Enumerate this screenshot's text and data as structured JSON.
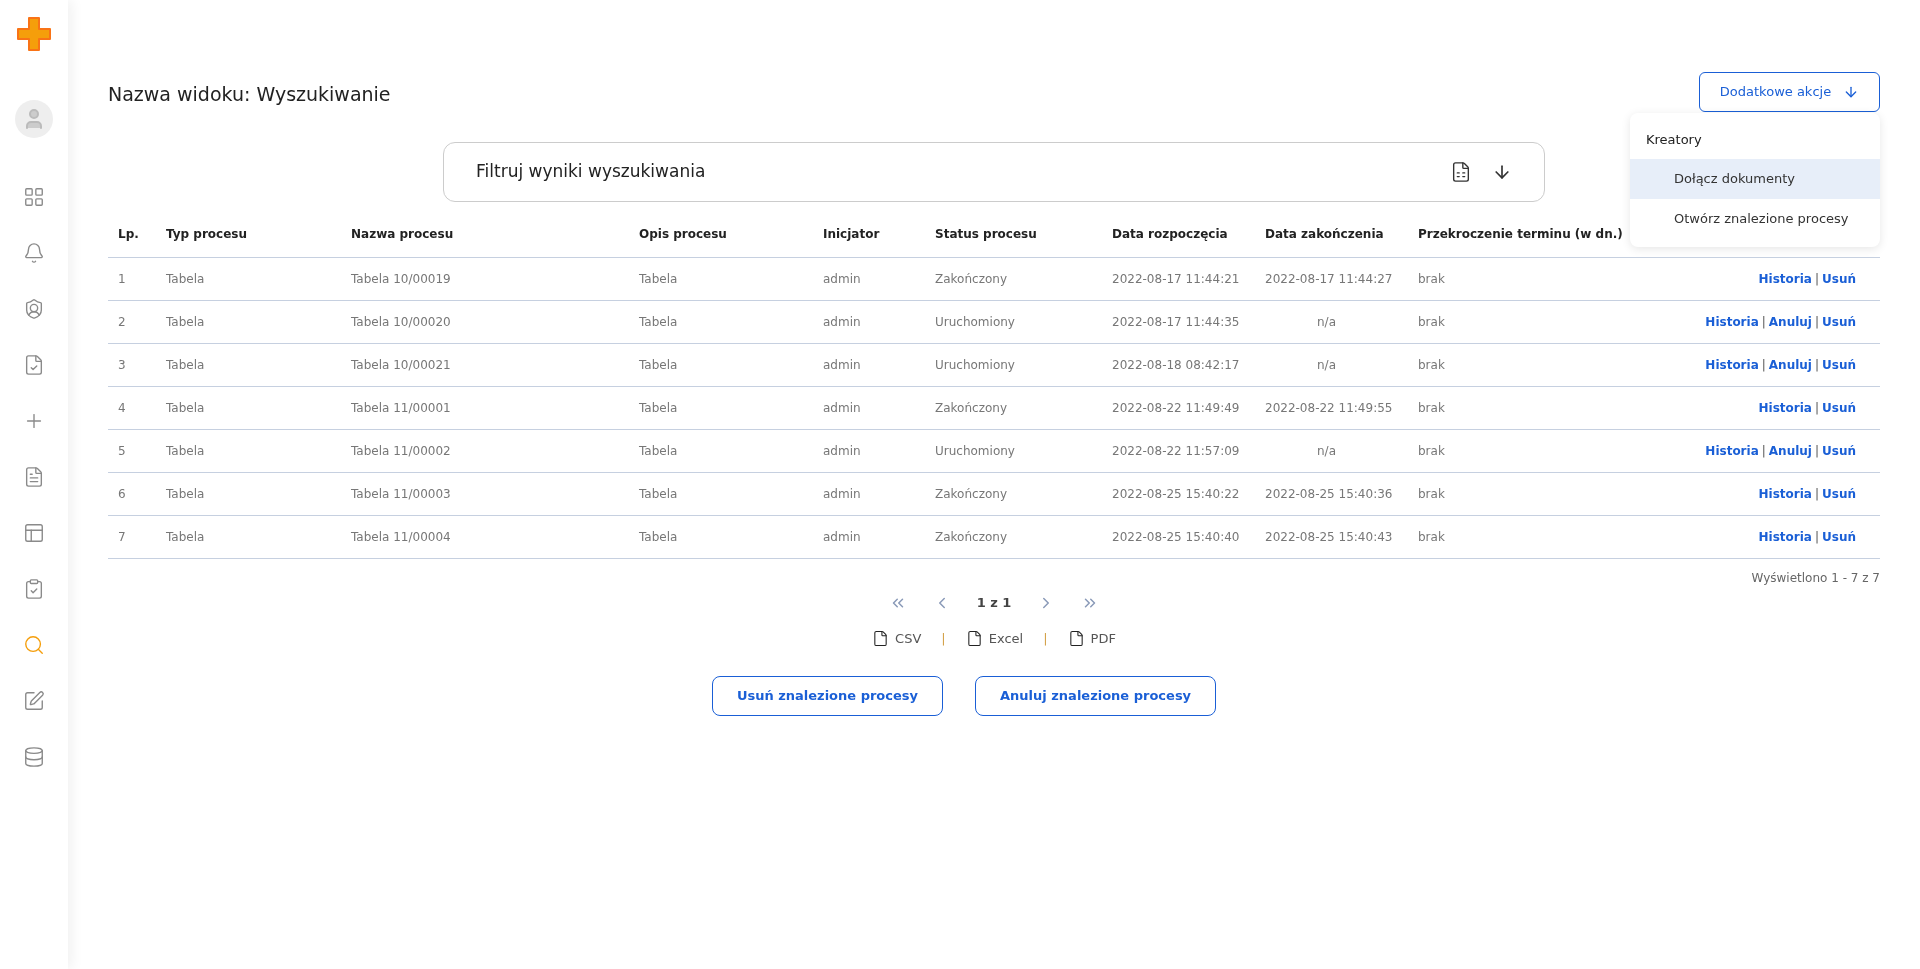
{
  "sidebar": {
    "items": [
      {
        "selected": false
      },
      {
        "selected": false
      },
      {
        "selected": false
      },
      {
        "selected": false
      },
      {
        "selected": false
      },
      {
        "selected": false
      },
      {
        "selected": false
      },
      {
        "selected": false
      },
      {
        "selected": true
      },
      {
        "selected": false
      },
      {
        "selected": false
      }
    ]
  },
  "title": "Nazwa widoku: Wyszukiwanie",
  "actions_menu": {
    "label": "Dodatkowe akcje",
    "expanded": true,
    "heading": "Kreatory",
    "items": [
      {
        "label": "Dołącz dokumenty",
        "selected": true
      },
      {
        "label": "Otwórz znalezione procesy",
        "selected": false
      }
    ]
  },
  "filter": {
    "label": "Filtruj wyniki wyszukiwania"
  },
  "table": {
    "columns": [
      "Lp.",
      "Typ procesu",
      "Nazwa procesu",
      "Opis procesu",
      "Inicjator",
      "Status procesu",
      "Data rozpoczęcia",
      "Data zakończenia",
      "Przekroczenie terminu (w dn.)"
    ],
    "rows": [
      {
        "cells": [
          "1",
          "Tabela",
          "Tabela 10/00019",
          "Tabela",
          "admin",
          "Zakończony",
          "2022-08-17 11:44:21",
          "2022-08-17 11:44:27",
          "brak"
        ],
        "links": [
          "Historia",
          "Usuń"
        ]
      },
      {
        "cells": [
          "2",
          "Tabela",
          "Tabela 10/00020",
          "Tabela",
          "admin",
          "Uruchomiony",
          "2022-08-17 11:44:35",
          "n/a",
          "brak"
        ],
        "links": [
          "Historia",
          "Anuluj",
          "Usuń"
        ]
      },
      {
        "cells": [
          "3",
          "Tabela",
          "Tabela 10/00021",
          "Tabela",
          "admin",
          "Uruchomiony",
          "2022-08-18 08:42:17",
          "n/a",
          "brak"
        ],
        "links": [
          "Historia",
          "Anuluj",
          "Usuń"
        ]
      },
      {
        "cells": [
          "4",
          "Tabela",
          "Tabela 11/00001",
          "Tabela",
          "admin",
          "Zakończony",
          "2022-08-22 11:49:49",
          "2022-08-22 11:49:55",
          "brak"
        ],
        "links": [
          "Historia",
          "Usuń"
        ]
      },
      {
        "cells": [
          "5",
          "Tabela",
          "Tabela 11/00002",
          "Tabela",
          "admin",
          "Uruchomiony",
          "2022-08-22 11:57:09",
          "n/a",
          "brak"
        ],
        "links": [
          "Historia",
          "Anuluj",
          "Usuń"
        ]
      },
      {
        "cells": [
          "6",
          "Tabela",
          "Tabela 11/00003",
          "Tabela",
          "admin",
          "Zakończony",
          "2022-08-25 15:40:22",
          "2022-08-25 15:40:36",
          "brak"
        ],
        "links": [
          "Historia",
          "Usuń"
        ]
      },
      {
        "cells": [
          "7",
          "Tabela",
          "Tabela 11/00004",
          "Tabela",
          "admin",
          "Zakończony",
          "2022-08-25 15:40:40",
          "2022-08-25 15:40:43",
          "brak"
        ],
        "links": [
          "Historia",
          "Usuń"
        ]
      }
    ],
    "link_separator": "|",
    "summary": "Wyświetlono 1 - 7 z 7"
  },
  "pagination": {
    "page": "1 z 1"
  },
  "exports": {
    "items": [
      "CSV",
      "Excel",
      "PDF"
    ],
    "separator": "|"
  },
  "buttons": [
    "Usuń znalezione procesy",
    "Anuluj znalezione procesy"
  ]
}
